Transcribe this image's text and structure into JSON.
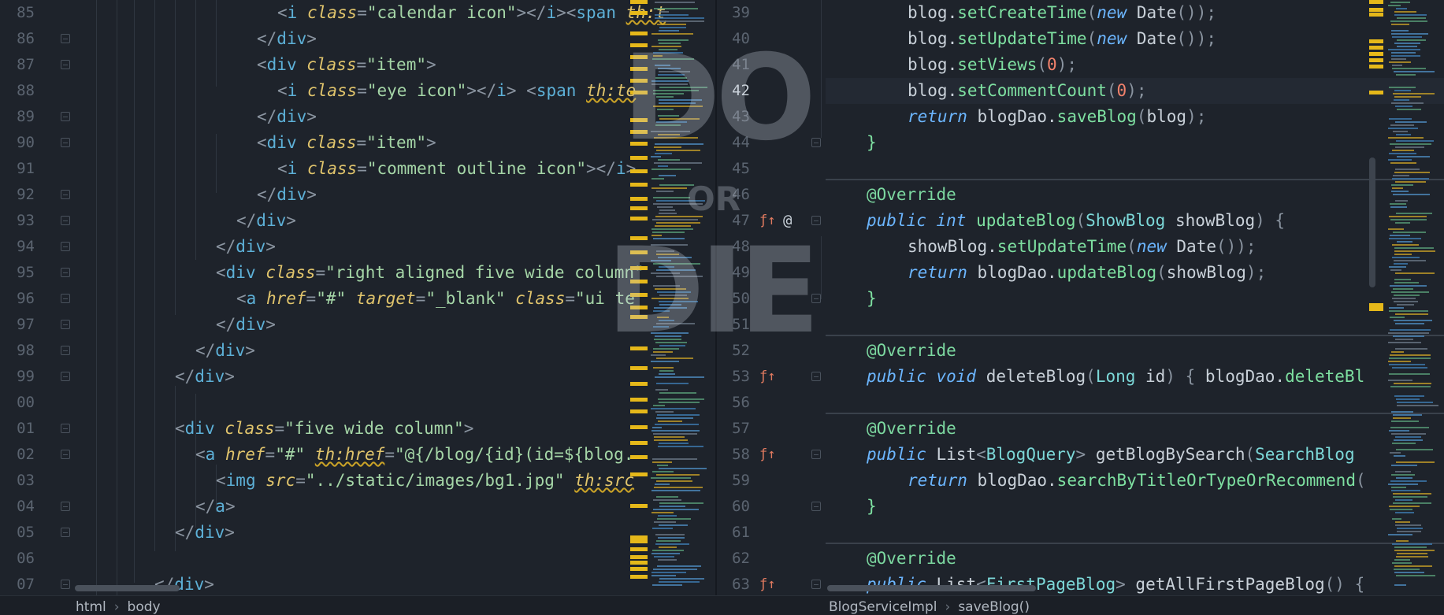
{
  "left_editor": {
    "line_numbers": [
      "85",
      "86",
      "87",
      "88",
      "89",
      "90",
      "91",
      "92",
      "93",
      "94",
      "95",
      "96",
      "97",
      "98",
      "99",
      "00",
      "01",
      "02",
      "03",
      "04",
      "05",
      "06",
      "07"
    ],
    "lines": [
      [
        [
          "t-punc",
          "<"
        ],
        [
          "t-tag",
          "i"
        ],
        [
          "t-var",
          " "
        ],
        [
          "t-attr",
          "class"
        ],
        [
          "t-punc",
          "="
        ],
        [
          "t-str",
          "\"calendar icon\""
        ],
        [
          "t-punc",
          "></"
        ],
        [
          "t-tag",
          "i"
        ],
        [
          "t-punc",
          "><"
        ],
        [
          "t-tag",
          "span"
        ],
        [
          "t-var",
          " "
        ],
        [
          "t-th",
          "th:t"
        ]
      ],
      [
        [
          "t-punc",
          "</"
        ],
        [
          "t-tag",
          "div"
        ],
        [
          "t-punc",
          ">"
        ]
      ],
      [
        [
          "t-punc",
          "<"
        ],
        [
          "t-tag",
          "div"
        ],
        [
          "t-var",
          " "
        ],
        [
          "t-attr",
          "class"
        ],
        [
          "t-punc",
          "="
        ],
        [
          "t-str",
          "\"item\""
        ],
        [
          "t-punc",
          ">"
        ]
      ],
      [
        [
          "t-punc",
          "<"
        ],
        [
          "t-tag",
          "i"
        ],
        [
          "t-var",
          " "
        ],
        [
          "t-attr",
          "class"
        ],
        [
          "t-punc",
          "="
        ],
        [
          "t-str",
          "\"eye icon\""
        ],
        [
          "t-punc",
          "></"
        ],
        [
          "t-tag",
          "i"
        ],
        [
          "t-punc",
          "> <"
        ],
        [
          "t-tag",
          "span"
        ],
        [
          "t-var",
          " "
        ],
        [
          "t-th",
          "th:te"
        ]
      ],
      [
        [
          "t-punc",
          "</"
        ],
        [
          "t-tag",
          "div"
        ],
        [
          "t-punc",
          ">"
        ]
      ],
      [
        [
          "t-punc",
          "<"
        ],
        [
          "t-tag",
          "div"
        ],
        [
          "t-var",
          " "
        ],
        [
          "t-attr",
          "class"
        ],
        [
          "t-punc",
          "="
        ],
        [
          "t-str",
          "\"item\""
        ],
        [
          "t-punc",
          ">"
        ]
      ],
      [
        [
          "t-punc",
          "<"
        ],
        [
          "t-tag",
          "i"
        ],
        [
          "t-var",
          " "
        ],
        [
          "t-attr",
          "class"
        ],
        [
          "t-punc",
          "="
        ],
        [
          "t-str",
          "\"comment outline icon\""
        ],
        [
          "t-punc",
          "></"
        ],
        [
          "t-tag",
          "i"
        ],
        [
          "t-punc",
          ">"
        ]
      ],
      [
        [
          "t-punc",
          "</"
        ],
        [
          "t-tag",
          "div"
        ],
        [
          "t-punc",
          ">"
        ]
      ],
      [
        [
          "t-punc",
          "</"
        ],
        [
          "t-tag",
          "div"
        ],
        [
          "t-punc",
          ">"
        ]
      ],
      [
        [
          "t-punc",
          "</"
        ],
        [
          "t-tag",
          "div"
        ],
        [
          "t-punc",
          ">"
        ]
      ],
      [
        [
          "t-punc",
          "<"
        ],
        [
          "t-tag",
          "div"
        ],
        [
          "t-var",
          " "
        ],
        [
          "t-attr",
          "class"
        ],
        [
          "t-punc",
          "="
        ],
        [
          "t-str",
          "\"right aligned five wide column\""
        ]
      ],
      [
        [
          "t-punc",
          "<"
        ],
        [
          "t-tag",
          "a"
        ],
        [
          "t-var",
          " "
        ],
        [
          "t-attr",
          "href"
        ],
        [
          "t-punc",
          "="
        ],
        [
          "t-str",
          "\"#\""
        ],
        [
          "t-var",
          " "
        ],
        [
          "t-attr",
          "target"
        ],
        [
          "t-punc",
          "="
        ],
        [
          "t-str",
          "\"_blank\""
        ],
        [
          "t-var",
          " "
        ],
        [
          "t-attr",
          "class"
        ],
        [
          "t-punc",
          "="
        ],
        [
          "t-str",
          "\"ui te"
        ]
      ],
      [
        [
          "t-punc",
          "</"
        ],
        [
          "t-tag",
          "div"
        ],
        [
          "t-punc",
          ">"
        ]
      ],
      [
        [
          "t-punc",
          "</"
        ],
        [
          "t-tag",
          "div"
        ],
        [
          "t-punc",
          ">"
        ]
      ],
      [
        [
          "t-punc",
          "</"
        ],
        [
          "t-tag",
          "div"
        ],
        [
          "t-punc",
          ">"
        ]
      ],
      [],
      [
        [
          "t-punc",
          "<"
        ],
        [
          "t-tag",
          "div"
        ],
        [
          "t-var",
          " "
        ],
        [
          "t-attr",
          "class"
        ],
        [
          "t-punc",
          "="
        ],
        [
          "t-str",
          "\"five wide column\""
        ],
        [
          "t-punc",
          ">"
        ]
      ],
      [
        [
          "t-punc",
          "<"
        ],
        [
          "t-tag",
          "a"
        ],
        [
          "t-var",
          " "
        ],
        [
          "t-attr",
          "href"
        ],
        [
          "t-punc",
          "="
        ],
        [
          "t-str",
          "\"#\""
        ],
        [
          "t-var",
          " "
        ],
        [
          "t-th",
          "th:href"
        ],
        [
          "t-punc",
          "="
        ],
        [
          "t-str",
          "\"@{/blog/{id}(id=${blog."
        ]
      ],
      [
        [
          "t-punc",
          "<"
        ],
        [
          "t-tag",
          "img"
        ],
        [
          "t-var",
          " "
        ],
        [
          "t-attr",
          "src"
        ],
        [
          "t-punc",
          "="
        ],
        [
          "t-str",
          "\"../static/images/bg1.jpg\""
        ],
        [
          "t-var",
          " "
        ],
        [
          "t-th",
          "th:src"
        ]
      ],
      [
        [
          "t-punc",
          "</"
        ],
        [
          "t-tag",
          "a"
        ],
        [
          "t-punc",
          ">"
        ]
      ],
      [
        [
          "t-punc",
          "</"
        ],
        [
          "t-tag",
          "div"
        ],
        [
          "t-punc",
          ">"
        ]
      ],
      [],
      [
        [
          "t-punc",
          "</"
        ],
        [
          "t-tag",
          "div"
        ],
        [
          "t-punc",
          ">"
        ]
      ]
    ]
  },
  "right_editor": {
    "line_numbers": [
      "39",
      "40",
      "41",
      "42",
      "43",
      "44",
      "45",
      "46",
      "47",
      "48",
      "49",
      "50",
      "51",
      "52",
      "53",
      "56",
      "57",
      "58",
      "59",
      "60",
      "61",
      "62",
      "63"
    ],
    "active_line": "42",
    "lines": [
      [
        [
          "t-var",
          "blog."
        ],
        [
          "t-fn",
          "setCreateTime"
        ],
        [
          "t-punc",
          "("
        ],
        [
          "t-kw",
          "new "
        ],
        [
          "t-var",
          "Date"
        ],
        [
          "t-punc",
          "());"
        ]
      ],
      [
        [
          "t-var",
          "blog."
        ],
        [
          "t-fn",
          "setUpdateTime"
        ],
        [
          "t-punc",
          "("
        ],
        [
          "t-kw",
          "new "
        ],
        [
          "t-var",
          "Date"
        ],
        [
          "t-punc",
          "());"
        ]
      ],
      [
        [
          "t-var",
          "blog."
        ],
        [
          "t-fn",
          "setViews"
        ],
        [
          "t-punc",
          "("
        ],
        [
          "t-num",
          "0"
        ],
        [
          "t-punc",
          ");"
        ]
      ],
      [
        [
          "t-var",
          "blog."
        ],
        [
          "t-fn",
          "setCommentCount"
        ],
        [
          "t-punc",
          "("
        ],
        [
          "t-num",
          "0"
        ],
        [
          "t-punc",
          ");"
        ]
      ],
      [
        [
          "t-kw",
          "return "
        ],
        [
          "t-var",
          "blogDao."
        ],
        [
          "t-fn",
          "saveBlog"
        ],
        [
          "t-punc",
          "("
        ],
        [
          "t-var",
          "blog"
        ],
        [
          "t-punc",
          ");"
        ]
      ],
      [
        [
          "t-fn",
          "}"
        ]
      ],
      [],
      [
        [
          "t-ann",
          "@Override"
        ]
      ],
      [
        [
          "t-kw",
          "public int "
        ],
        [
          "t-fn",
          "updateBlog"
        ],
        [
          "t-punc",
          "("
        ],
        [
          "t-type",
          "ShowBlog "
        ],
        [
          "t-var",
          "showBlog"
        ],
        [
          "t-punc",
          ") {"
        ]
      ],
      [
        [
          "t-var",
          "showBlog."
        ],
        [
          "t-fn",
          "setUpdateTime"
        ],
        [
          "t-punc",
          "("
        ],
        [
          "t-kw",
          "new "
        ],
        [
          "t-var",
          "Date"
        ],
        [
          "t-punc",
          "());"
        ]
      ],
      [
        [
          "t-kw",
          "return "
        ],
        [
          "t-var",
          "blogDao."
        ],
        [
          "t-fn",
          "updateBlog"
        ],
        [
          "t-punc",
          "("
        ],
        [
          "t-var",
          "showBlog"
        ],
        [
          "t-punc",
          ");"
        ]
      ],
      [
        [
          "t-fn",
          "}"
        ]
      ],
      [],
      [
        [
          "t-ann",
          "@Override"
        ]
      ],
      [
        [
          "t-kw",
          "public void "
        ],
        [
          "t-var",
          "deleteBlog"
        ],
        [
          "t-punc",
          "("
        ],
        [
          "t-type",
          "Long "
        ],
        [
          "t-var",
          "id"
        ],
        [
          "t-punc",
          ") { "
        ],
        [
          "t-var",
          "blogDao."
        ],
        [
          "t-fn",
          "deleteBl"
        ]
      ],
      [],
      [
        [
          "t-ann",
          "@Override"
        ]
      ],
      [
        [
          "t-kw",
          "public "
        ],
        [
          "t-var",
          "List"
        ],
        [
          "t-punc",
          "<"
        ],
        [
          "t-type",
          "BlogQuery"
        ],
        [
          "t-punc",
          "> "
        ],
        [
          "t-var",
          "getBlogBySearch"
        ],
        [
          "t-punc",
          "("
        ],
        [
          "t-type",
          "SearchBlog"
        ]
      ],
      [
        [
          "t-kw",
          "return "
        ],
        [
          "t-var",
          "blogDao."
        ],
        [
          "t-fn",
          "searchByTitleOrTypeOrRecommend"
        ],
        [
          "t-punc",
          "("
        ]
      ],
      [
        [
          "t-fn",
          "}"
        ]
      ],
      [],
      [
        [
          "t-ann",
          "@Override"
        ]
      ],
      [
        [
          "t-kw",
          "public "
        ],
        [
          "t-var",
          "List"
        ],
        [
          "t-punc",
          "<"
        ],
        [
          "t-type",
          "FirstPageBlog"
        ],
        [
          "t-punc",
          "> "
        ],
        [
          "t-var",
          "getAllFirstPageBlog"
        ],
        [
          "t-punc",
          "() {"
        ]
      ]
    ]
  },
  "watermark": {
    "word1": "DO",
    "word2": "OR",
    "word3": "DIE"
  },
  "statusbar": {
    "left_crumbs": [
      "html",
      "body"
    ],
    "right_crumbs": [
      "BlogServiceImpl",
      "saveBlog()"
    ]
  },
  "gutter_icons": {
    "override": "fx-up-arrow-icon",
    "annotation": "@"
  },
  "colors": {
    "background": "#1e232b",
    "marker": "#e5b81a",
    "tag": "#5db0d7",
    "attribute": "#e0c46c",
    "string": "#a5d6a7",
    "keyword": "#6cb6ff",
    "function": "#7ee0a1",
    "number": "#f2826c"
  }
}
